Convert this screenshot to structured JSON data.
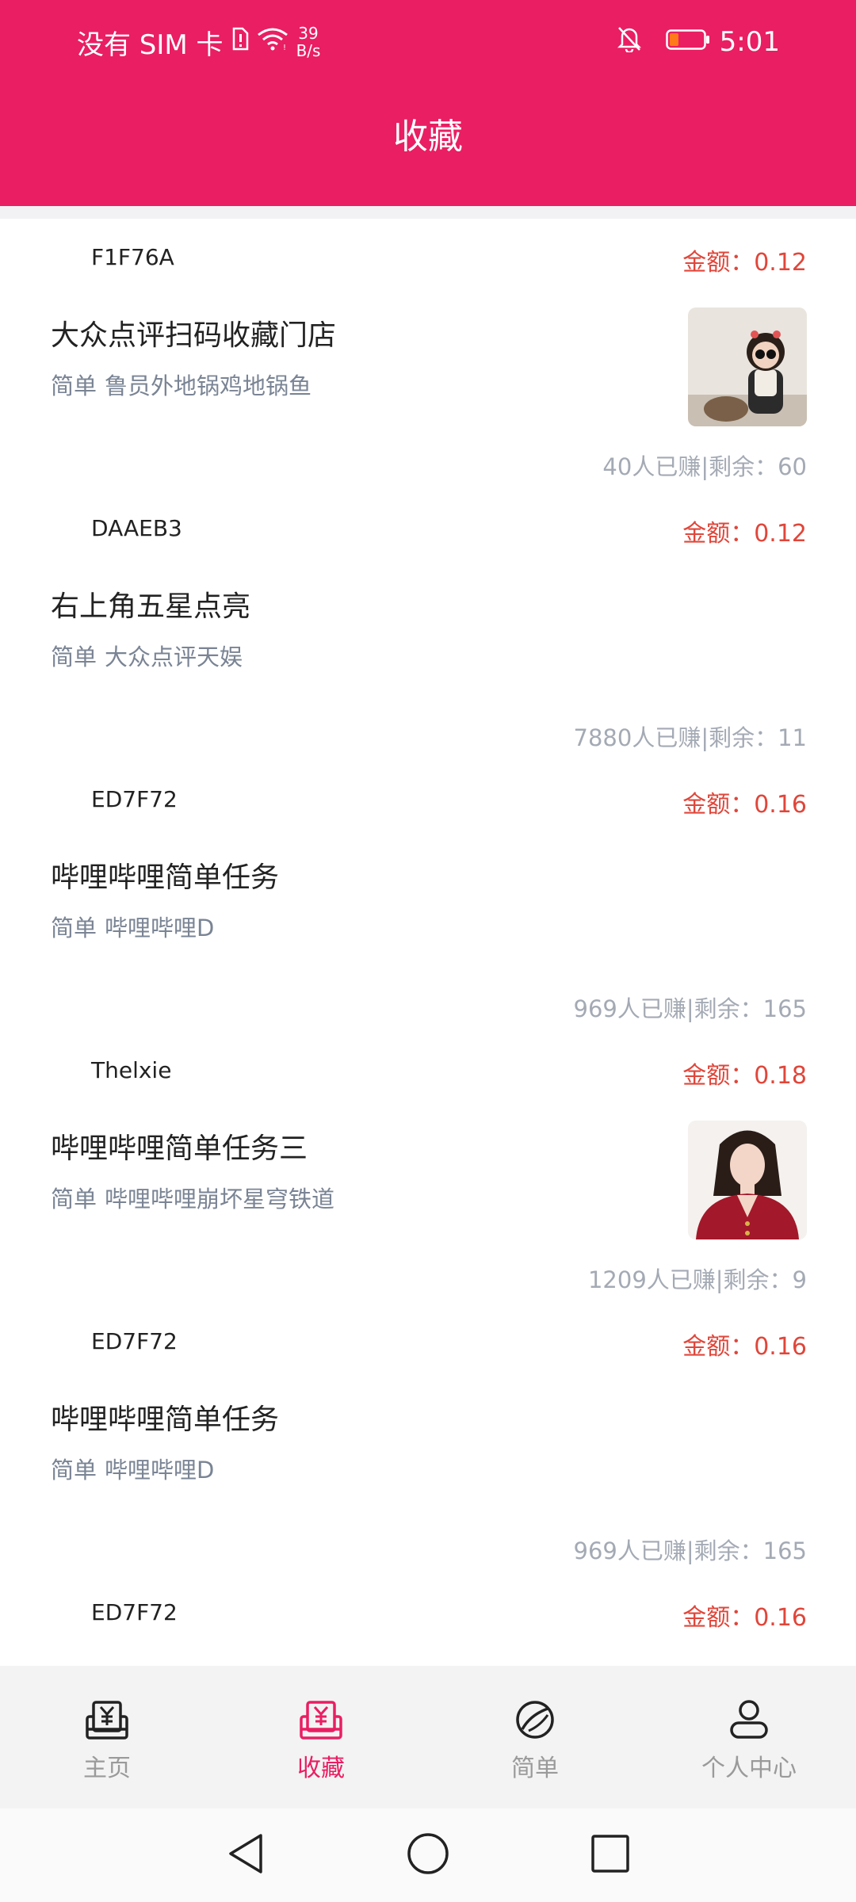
{
  "status_bar": {
    "carrier": "没有 SIM 卡",
    "net_speed_value": "39",
    "net_speed_unit": "B/s",
    "time": "5:01",
    "battery_color": "#FF7A1A"
  },
  "header": {
    "title": "收藏"
  },
  "tasks": [
    {
      "code": "F1F76A",
      "amount": "金额：0.12",
      "title": "大众点评扫码收藏门店",
      "difficulty": "简单",
      "app": "鲁员外地锅鸡地锅鱼",
      "stats": "40人已赚|剩余：60",
      "has_thumb": true
    },
    {
      "code": "DAAEB3",
      "amount": "金额：0.12",
      "title": "右上角五星点亮",
      "difficulty": "简单",
      "app": "大众点评天娱",
      "stats": "7880人已赚|剩余：11",
      "has_thumb": false
    },
    {
      "code": "ED7F72",
      "amount": "金额：0.16",
      "title": "哔哩哔哩简单任务",
      "difficulty": "简单",
      "app": "哔哩哔哩D",
      "stats": "969人已赚|剩余：165",
      "has_thumb": false
    },
    {
      "code": "Thelxie",
      "amount": "金额：0.18",
      "title": "哔哩哔哩简单任务三",
      "difficulty": "简单",
      "app": "哔哩哔哩崩坏星穹铁道",
      "stats": "1209人已赚|剩余：9",
      "has_thumb": true
    },
    {
      "code": "ED7F72",
      "amount": "金额：0.16",
      "title": "哔哩哔哩简单任务",
      "difficulty": "简单",
      "app": "哔哩哔哩D",
      "stats": "969人已赚|剩余：165",
      "has_thumb": false
    },
    {
      "code": "ED7F72",
      "amount": "金额：0.16"
    }
  ],
  "bottom_nav": [
    {
      "label": "主页",
      "icon": "home-yuan-icon"
    },
    {
      "label": "收藏",
      "icon": "favorites-yuan-icon",
      "active": true
    },
    {
      "label": "简单",
      "icon": "planet-icon"
    },
    {
      "label": "个人中心",
      "icon": "person-icon"
    }
  ],
  "colors": {
    "accent": "#E91E63",
    "amount": "#E0463A",
    "subtitle": "#7A8494",
    "stats": "#A4AAB4"
  }
}
